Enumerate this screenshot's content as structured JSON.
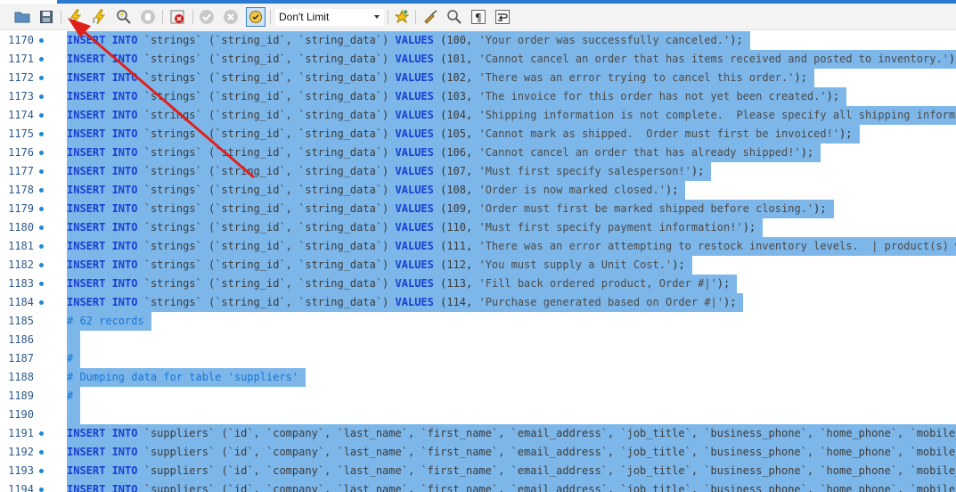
{
  "toolbar": {
    "limit_value": "Don't Limit",
    "icons": [
      "open-folder",
      "save",
      "execute",
      "execute-current",
      "explain",
      "stop",
      "stop-on-error",
      "commit",
      "rollback",
      "autocommit",
      "beautify",
      "find",
      "invisible-chars",
      "wrap-lines"
    ]
  },
  "editor": {
    "lines": [
      {
        "n": "1170",
        "kind": "insert_strings",
        "v": "100",
        "s": "'Your order was successfully canceled.'",
        "end": ");"
      },
      {
        "n": "1171",
        "kind": "insert_strings",
        "v": "101",
        "s": "'Cannot cancel an order that has items received and posted to inventory.'",
        "end": ");"
      },
      {
        "n": "1172",
        "kind": "insert_strings",
        "v": "102",
        "s": "'There was an error trying to cancel this order.'",
        "end": ");"
      },
      {
        "n": "1173",
        "kind": "insert_strings",
        "v": "103",
        "s": "'The invoice for this order has not yet been created.'",
        "end": ");"
      },
      {
        "n": "1174",
        "kind": "insert_strings",
        "v": "104",
        "s": "'Shipping information is not complete.  Please specify all shipping information",
        "end": ""
      },
      {
        "n": "1175",
        "kind": "insert_strings",
        "v": "105",
        "s": "'Cannot mark as shipped.  Order must first be invoiced!'",
        "end": ");"
      },
      {
        "n": "1176",
        "kind": "insert_strings",
        "v": "106",
        "s": "'Cannot cancel an order that has already shipped!'",
        "end": ");"
      },
      {
        "n": "1177",
        "kind": "insert_strings",
        "v": "107",
        "s": "'Must first specify salesperson!'",
        "end": ");"
      },
      {
        "n": "1178",
        "kind": "insert_strings",
        "v": "108",
        "s": "'Order is now marked closed.'",
        "end": ");"
      },
      {
        "n": "1179",
        "kind": "insert_strings",
        "v": "109",
        "s": "'Order must first be marked shipped before closing.'",
        "end": ");"
      },
      {
        "n": "1180",
        "kind": "insert_strings",
        "v": "110",
        "s": "'Must first specify payment information!'",
        "end": ");"
      },
      {
        "n": "1181",
        "kind": "insert_strings",
        "v": "111",
        "s": "'There was an error attempting to restock inventory levels.  | product(s) were",
        "end": ""
      },
      {
        "n": "1182",
        "kind": "insert_strings",
        "v": "112",
        "s": "'You must supply a Unit Cost.'",
        "end": ");"
      },
      {
        "n": "1183",
        "kind": "insert_strings",
        "v": "113",
        "s": "'Fill back ordered product, Order #|'",
        "end": ");"
      },
      {
        "n": "1184",
        "kind": "insert_strings",
        "v": "114",
        "s": "'Purchase generated based on Order #|'",
        "end": ");"
      },
      {
        "n": "1185",
        "kind": "comment",
        "text": "# 62 records"
      },
      {
        "n": "1186",
        "kind": "blank",
        "text": " "
      },
      {
        "n": "1187",
        "kind": "comment",
        "text": "#"
      },
      {
        "n": "1188",
        "kind": "comment",
        "text": "# Dumping data for table 'suppliers'"
      },
      {
        "n": "1189",
        "kind": "comment",
        "text": "#"
      },
      {
        "n": "1190",
        "kind": "blank",
        "text": " "
      },
      {
        "n": "1191",
        "kind": "insert_suppliers"
      },
      {
        "n": "1192",
        "kind": "insert_suppliers"
      },
      {
        "n": "1193",
        "kind": "insert_suppliers"
      },
      {
        "n": "1194",
        "kind": "insert_suppliers"
      }
    ],
    "tokens": {
      "insert_into": "INSERT INTO",
      "values": "VALUES",
      "strings_table": "`strings`",
      "strings_cols": "(`string_id`, `string_data`)",
      "suppliers_table": "`suppliers`",
      "suppliers_cols": "(`id`, `company`, `last_name`, `first_name`, `email_address`, `job_title`, `business_phone`, `home_phone`, `mobile_phor"
    }
  },
  "colors": {
    "selection": "#7db7ea",
    "keyword": "#1b3fd1",
    "comment": "#1875d6",
    "arrow": "#e0201a"
  }
}
